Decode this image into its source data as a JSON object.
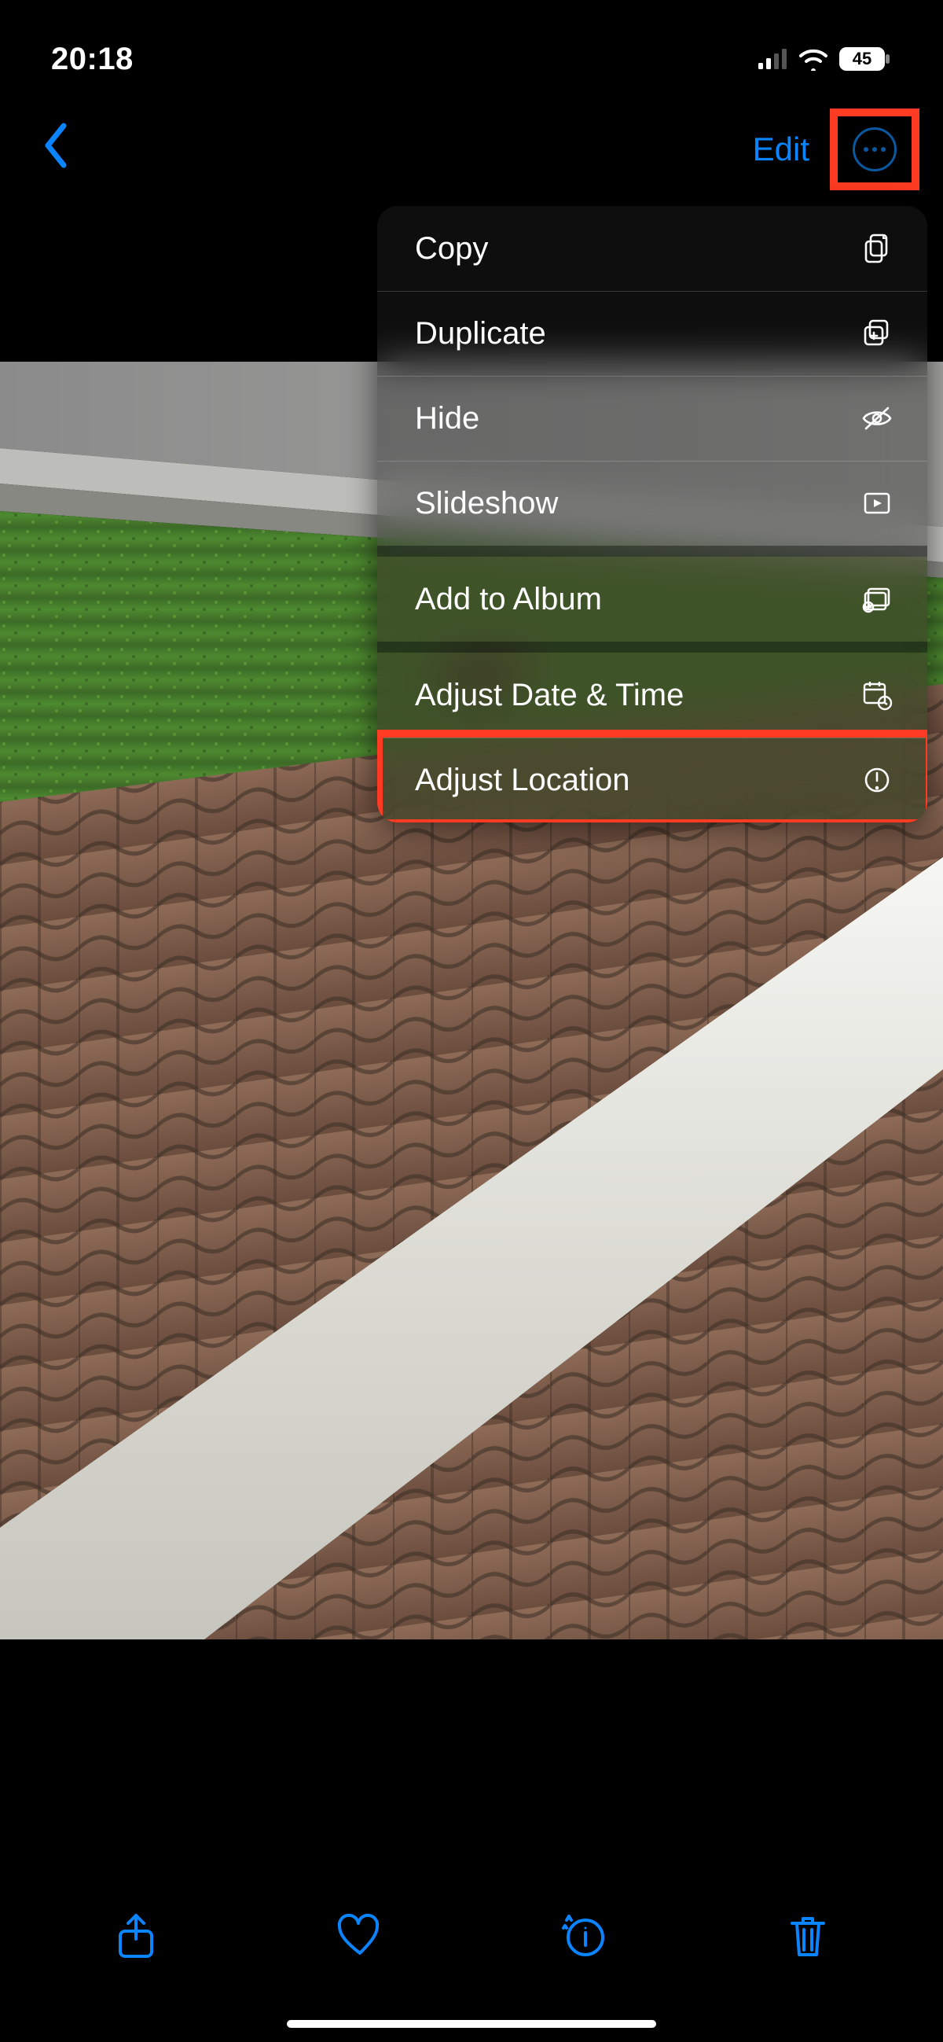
{
  "statusbar": {
    "time": "20:18",
    "battery_percent": "45"
  },
  "nav": {
    "edit_label": "Edit"
  },
  "menu": {
    "copy": "Copy",
    "duplicate": "Duplicate",
    "hide": "Hide",
    "slideshow": "Slideshow",
    "add_to_album": "Add to Album",
    "adjust_date_time": "Adjust Date & Time",
    "adjust_location": "Adjust Location"
  }
}
